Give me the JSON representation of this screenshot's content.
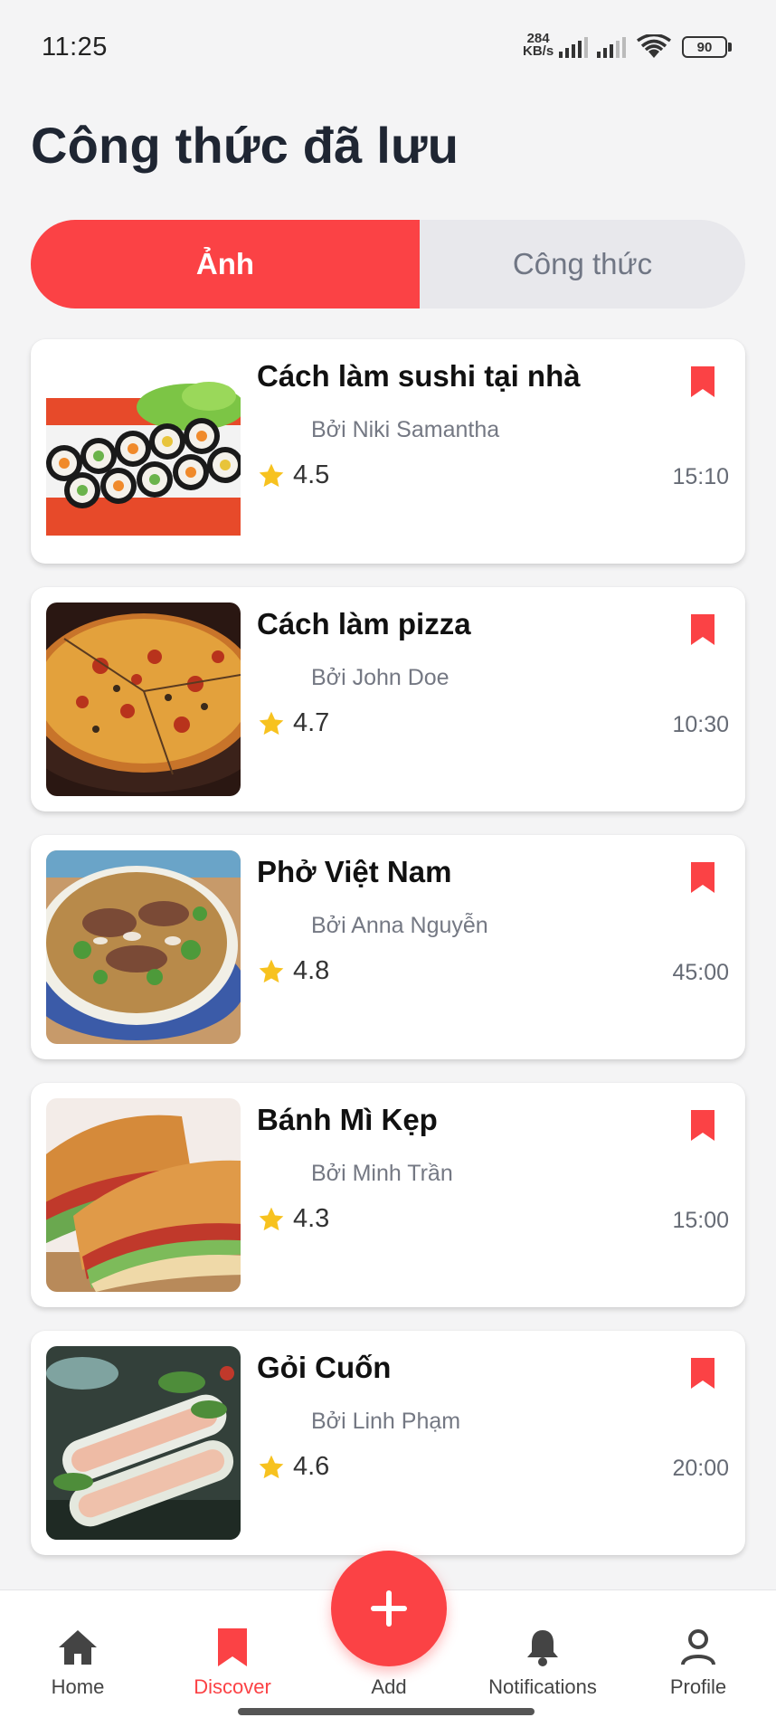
{
  "status_bar": {
    "time": "11:25",
    "net_speed_value": "284",
    "net_speed_unit": "KB/s",
    "battery": "90"
  },
  "page": {
    "title": "Công thức đã lưu"
  },
  "segmented": {
    "tabs": [
      {
        "label": "Ảnh",
        "active": true
      },
      {
        "label": "Công thức",
        "active": false
      }
    ]
  },
  "recipes": [
    {
      "name": "Cách làm sushi tại nhà",
      "author": "Bởi Niki Samantha",
      "rating": "4.5",
      "time": "15:10",
      "image": "sushi-rolls"
    },
    {
      "name": "Cách làm pizza",
      "author": "Bởi John Doe",
      "rating": "4.7",
      "time": "10:30",
      "image": "pizza"
    },
    {
      "name": "Phở Việt Nam",
      "author": "Bởi Anna Nguyễn",
      "rating": "4.8",
      "time": "45:00",
      "image": "pho-bowl"
    },
    {
      "name": "Bánh Mì Kẹp",
      "author": "Bởi Minh Trần",
      "rating": "4.3",
      "time": "15:00",
      "image": "banh-mi"
    },
    {
      "name": "Gỏi Cuốn",
      "author": "Bởi Linh Phạm",
      "rating": "4.6",
      "time": "20:00",
      "image": "spring-rolls"
    }
  ],
  "bottom_nav": {
    "items": [
      {
        "label": "Home",
        "icon": "home-icon",
        "active": false
      },
      {
        "label": "Discover",
        "icon": "bookmark-icon",
        "active": true
      },
      {
        "label": "Add",
        "icon": "plus-icon",
        "active": false
      },
      {
        "label": "Notifications",
        "icon": "bell-icon",
        "active": false
      },
      {
        "label": "Profile",
        "icon": "person-icon",
        "active": false
      }
    ]
  },
  "colors": {
    "accent": "#fb4245",
    "background": "#f4f4f5",
    "star": "#f7c21f"
  }
}
